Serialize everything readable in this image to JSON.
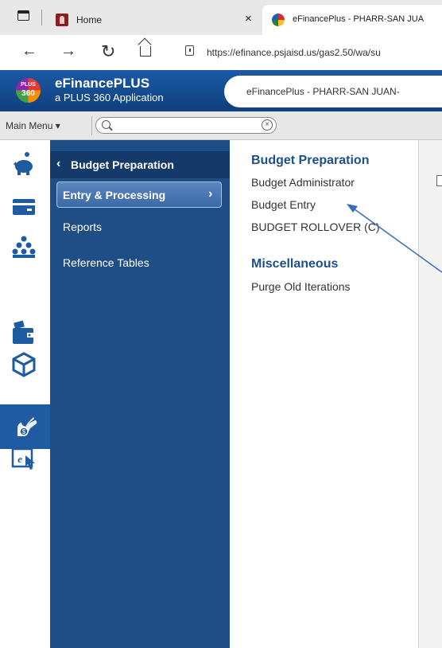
{
  "browser": {
    "tabs": [
      {
        "title": "Home",
        "close": "×"
      },
      {
        "title": "eFinancePlus - PHARR-SAN JUA"
      }
    ],
    "url": "https://efinance.psjaisd.us/gas2.50/wa/su",
    "nav": {
      "back": "←",
      "forward": "→",
      "reload": "↻"
    }
  },
  "app": {
    "logo_line1": "PLUS",
    "logo_line2": "360",
    "name": "eFinancePLUS",
    "subtitle": "a PLUS 360 Application",
    "pill_text": "eFinancePlus - PHARR-SAN JUAN-"
  },
  "toolbar": {
    "main_menu": "Main Menu ▾",
    "search_value": "",
    "clear": "×"
  },
  "rail": {
    "icons": [
      "piggy-bank-icon",
      "credit-card-icon",
      "people-icon",
      "hand-dollar-icon",
      "wallet-icon",
      "box-icon",
      "texas-icon",
      "efp-cursor-icon"
    ],
    "selected": "hand-dollar-icon"
  },
  "submenu": {
    "back": "‹",
    "title": "Budget Preparation",
    "items": [
      {
        "label": "Entry & Processing",
        "chevron": "›",
        "selected": true
      },
      {
        "label": "Reports"
      },
      {
        "label": "Reference Tables"
      }
    ]
  },
  "content": {
    "sections": [
      {
        "title": "Budget Preparation",
        "links": [
          "Budget Administrator",
          "Budget Entry",
          "BUDGET ROLLOVER (C)"
        ]
      },
      {
        "title": "Miscellaneous",
        "links": [
          "Purge Old Iterations"
        ]
      }
    ]
  },
  "colors": {
    "header_blue": "#1a5aa6",
    "submenu_blue": "#1f4e87",
    "section_title": "#1e4f8c",
    "annotation": "#3b6db8"
  }
}
